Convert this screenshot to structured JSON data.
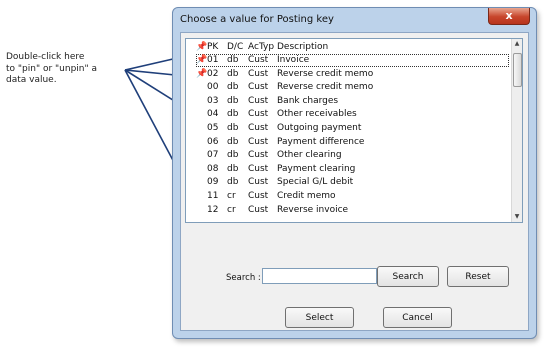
{
  "annotation": {
    "lines": [
      "Double-click here",
      "to \"pin\" or \"unpin\" a",
      "data value."
    ]
  },
  "dialog": {
    "title": "Choose a value for Posting key",
    "close_glyph": "x"
  },
  "table": {
    "headers": {
      "pin": "📌",
      "pk": "PK",
      "dc": "D/C",
      "actyp": "AcTyp",
      "description": "Description"
    },
    "rows": [
      {
        "pin": "📌",
        "pk": "01",
        "dc": "db",
        "actyp": "Cust",
        "description": "Invoice"
      },
      {
        "pin": "📌",
        "pk": "02",
        "dc": "db",
        "actyp": "Cust",
        "description": "Reverse credit memo"
      },
      {
        "pin": "",
        "pk": "00",
        "dc": "db",
        "actyp": "Cust",
        "description": "Reverse credit memo"
      },
      {
        "pin": "",
        "pk": "03",
        "dc": "db",
        "actyp": "Cust",
        "description": "Bank charges"
      },
      {
        "pin": "",
        "pk": "04",
        "dc": "db",
        "actyp": "Cust",
        "description": "Other receivables"
      },
      {
        "pin": "",
        "pk": "05",
        "dc": "db",
        "actyp": "Cust",
        "description": "Outgoing payment"
      },
      {
        "pin": "",
        "pk": "06",
        "dc": "db",
        "actyp": "Cust",
        "description": "Payment difference"
      },
      {
        "pin": "",
        "pk": "07",
        "dc": "db",
        "actyp": "Cust",
        "description": "Other clearing"
      },
      {
        "pin": "",
        "pk": "08",
        "dc": "db",
        "actyp": "Cust",
        "description": "Payment clearing"
      },
      {
        "pin": "",
        "pk": "09",
        "dc": "db",
        "actyp": "Cust",
        "description": "Special G/L debit"
      },
      {
        "pin": "",
        "pk": "11",
        "dc": "cr",
        "actyp": "Cust",
        "description": "Credit memo"
      },
      {
        "pin": "",
        "pk": "12",
        "dc": "cr",
        "actyp": "Cust",
        "description": "Reverse invoice"
      }
    ],
    "selected_index": 0
  },
  "search": {
    "label": "Search :",
    "value": "",
    "search_button": "Search",
    "reset_button": "Reset"
  },
  "footer": {
    "select_button": "Select",
    "cancel_button": "Cancel"
  },
  "icons": {
    "pin": "pin-icon",
    "close": "close-icon",
    "scroll_up": "scroll-up-arrow-icon",
    "scroll_down": "scroll-down-arrow-icon"
  },
  "colors": {
    "frame": "#bcd2ea",
    "close_button": "#c7452b",
    "arrow": "#1f3f7a"
  }
}
